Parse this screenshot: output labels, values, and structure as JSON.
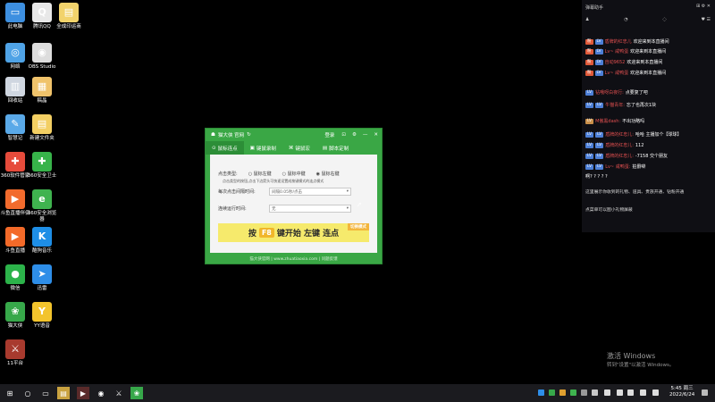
{
  "desktop": {
    "icons": [
      {
        "label": "此电脑",
        "glyph": "▭",
        "color": "#3d8fe0"
      },
      {
        "label": "腾讯QQ",
        "glyph": "Q",
        "color": "#e8e8e8"
      },
      {
        "label": "全成印运商",
        "glyph": "▤",
        "color": "#f2d36b"
      },
      {
        "label": "网络",
        "glyph": "◎",
        "color": "#4fa3e6"
      },
      {
        "label": "OBS Studio",
        "glyph": "◉",
        "color": "#ddd"
      },
      {
        "label": "回收站",
        "glyph": "▥",
        "color": "#cfd6e0"
      },
      {
        "label": "稿晶",
        "glyph": "▦",
        "color": "#f0c36b"
      },
      {
        "label": "智慧记",
        "glyph": "✎",
        "color": "#5aa9e8"
      },
      {
        "label": "新建文件夹",
        "glyph": "▤",
        "color": "#f3cf63"
      },
      {
        "label": "360软件管家",
        "glyph": "✚",
        "color": "#e64b3b"
      },
      {
        "label": "360安全卫士",
        "glyph": "✚",
        "color": "#37b34a"
      },
      {
        "label": "斗鱼直播伴侣",
        "glyph": "▶",
        "color": "#f26b2d"
      },
      {
        "label": "360安全浏览器",
        "glyph": "e",
        "color": "#3fb34f"
      },
      {
        "label": "斗鱼直播",
        "glyph": "▶",
        "color": "#f36a29"
      },
      {
        "label": "酷狗音乐",
        "glyph": "K",
        "color": "#1e8ee6"
      },
      {
        "label": "微信",
        "glyph": "●",
        "color": "#2cb34a"
      },
      {
        "label": "迅雷",
        "glyph": "➤",
        "color": "#2e8ee8"
      },
      {
        "label": "猫大侠",
        "glyph": "❀",
        "color": "#37a84a"
      },
      {
        "label": "YY语音",
        "glyph": "Y",
        "color": "#f3c42c"
      },
      {
        "label": "11平台",
        "glyph": "⚔",
        "color": "#a83a2e"
      }
    ]
  },
  "app": {
    "title": "猫大侠 官网",
    "header_links": [
      "登录",
      "⊡",
      "⚙",
      "—",
      "✕"
    ],
    "tabs": [
      "鼠标连点",
      "键鼠录制",
      "键鼠宏",
      "脚本定制"
    ],
    "click_type_label": "点击类型:",
    "click_options": [
      "鼠标左键",
      "鼠标中键",
      "鼠标右键"
    ],
    "notice": "点击类型的按钮,点击下边箭头可快速设置成按键模式的连点模式",
    "interval_label": "每次点击间隔时间:",
    "interval_value": "间隔0.05秒/点击",
    "run_label": "连续运行时间:",
    "run_value": "无",
    "big_button_pre": "按",
    "big_button_key": "F8",
    "big_button_post": "键开始 左键 连点",
    "big_button_tag": "切换模式",
    "footer": "猫大侠官网 | www.zhuatiaoxia.com | 问题反馈"
  },
  "chat": {
    "title": "弹幕助手",
    "rows": [
      {
        "badges": [
          {
            "t": "粉",
            "c": "#e05a3a"
          },
          {
            "t": "LV",
            "c": "#4d7fd6"
          }
        ],
        "name": "盾牌的红忠儿",
        "msg": "欢迎来到本直播间"
      },
      {
        "badges": [
          {
            "t": "粉",
            "c": "#e05a3a"
          },
          {
            "t": "LV",
            "c": "#4d7fd6"
          }
        ],
        "name": "Lv~ 咸鸭蛋",
        "msg": "欢迎来到本直播间"
      },
      {
        "badges": [
          {
            "t": "粉",
            "c": "#e05a3a"
          },
          {
            "t": "LV",
            "c": "#4d7fd6"
          }
        ],
        "name": "自动9652",
        "msg": "欢迎来到本直播间"
      },
      {
        "badges": [
          {
            "t": "粉",
            "c": "#e05a3a"
          },
          {
            "t": "LV",
            "c": "#4d7fd6"
          }
        ],
        "name": "Lv~ 咸鸭蛋",
        "msg": "欢迎来到本直播间"
      },
      {
        "badges": [
          {
            "t": "LV",
            "c": "#4d7fd6"
          }
        ],
        "name": "钻哦呀白夜行:",
        "msg": "点要复了吧"
      },
      {
        "badges": [
          {
            "t": "LV",
            "c": "#4d7fd6"
          },
          {
            "t": "LV",
            "c": "#4d7fd6"
          }
        ],
        "name": "牛猫青年:",
        "msg": "忘了也再次1块"
      },
      {
        "badges": [
          {
            "t": "LV",
            "c": "#c9904a"
          }
        ],
        "name": "M傲黑dash:",
        "msg": "不出功略吗"
      },
      {
        "badges": [
          {
            "t": "LV",
            "c": "#4d7fd6"
          },
          {
            "t": "LV",
            "c": "#4d7fd6"
          }
        ],
        "name": "盾牌的红忠儿:",
        "msg": "哈哈 主播加个【球球】"
      },
      {
        "badges": [
          {
            "t": "LV",
            "c": "#4d7fd6"
          },
          {
            "t": "LV",
            "c": "#4d7fd6"
          }
        ],
        "name": "盾牌的红忠儿:",
        "msg": "112"
      },
      {
        "badges": [
          {
            "t": "LV",
            "c": "#4d7fd6"
          },
          {
            "t": "LV",
            "c": "#4d7fd6"
          }
        ],
        "name": "盾牌的红忠儿:",
        "msg": "-7158 交个朋友"
      },
      {
        "badges": [
          {
            "t": "LV",
            "c": "#4d7fd6"
          },
          {
            "t": "LV",
            "c": "#4d7fd6"
          }
        ],
        "name": "Lv~ 咸鸭蛋:",
        "msg": "拍爵噼"
      },
      {
        "badges": [],
        "name": "",
        "msg": "啊? ? ? ? ?"
      }
    ],
    "notice1": "这里展示你收到的礼物、道具、贵族开通、钻粉开通",
    "notice2": "点菜单可以图小礼物屏蔽"
  },
  "watermark": {
    "line1": "激活 Windows",
    "line2": "转到\"设置\"以激活 Windows。"
  },
  "taskbar": {
    "time": "5:45 周三",
    "date": "2022/6/24"
  }
}
